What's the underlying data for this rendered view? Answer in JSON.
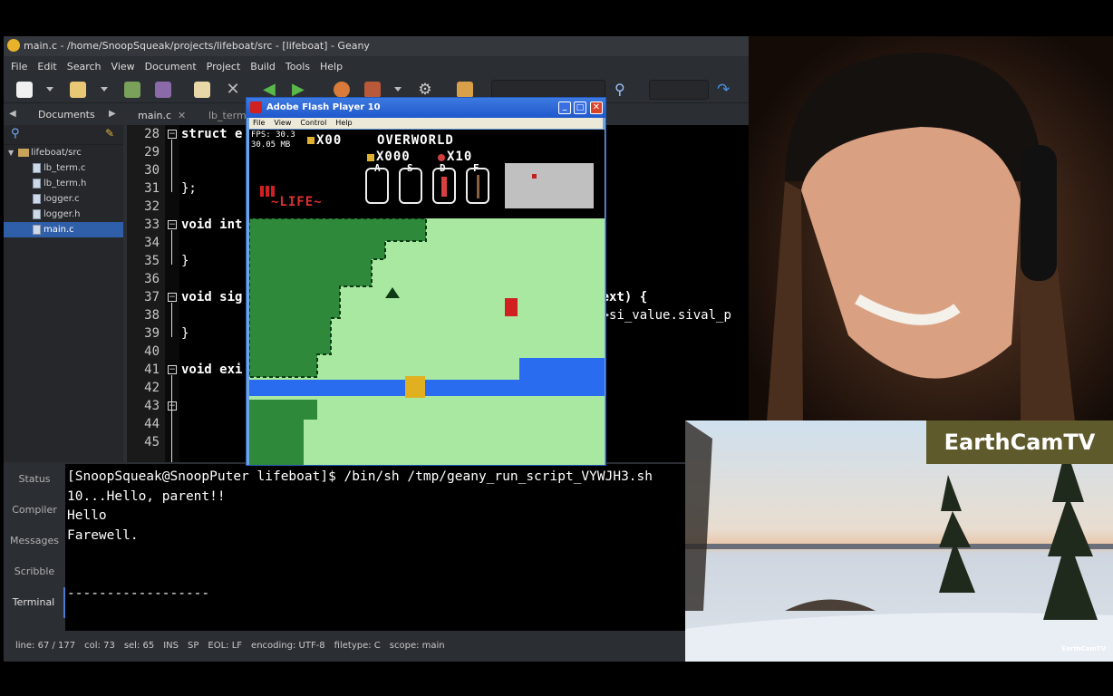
{
  "geany": {
    "title": "main.c - /home/SnoopSqueak/projects/lifeboat/src - [lifeboat] - Geany",
    "menu": [
      "File",
      "Edit",
      "Search",
      "View",
      "Document",
      "Project",
      "Build",
      "Tools",
      "Help"
    ],
    "sidebar_tab": "Documents",
    "tree": {
      "folder": "lifeboat/src",
      "files": [
        "lb_term.c",
        "lb_term.h",
        "logger.c",
        "logger.h",
        "main.c"
      ],
      "selected": "main.c"
    },
    "editor_tabs": [
      "main.c",
      "lb_term"
    ],
    "line_numbers": [
      "28",
      "29",
      "30",
      "31",
      "32",
      "33",
      "34",
      "35",
      "36",
      "37",
      "38",
      "39",
      "40",
      "41",
      "42",
      "43",
      "44",
      "45"
    ],
    "code_lines": [
      "struct e",
      "",
      "",
      "};",
      "",
      "void int",
      "",
      "}",
      "",
      "void sig                                             ntext) {",
      "                                                     p->si_value.sival_p",
      "}",
      "",
      "void exi",
      "",
      "",
      "",
      ""
    ],
    "message_tabs": [
      "Status",
      "Compiler",
      "Messages",
      "Scribble",
      "Terminal"
    ],
    "active_message_tab": "Terminal",
    "terminal_lines": [
      "[SnoopSqueak@SnoopPuter lifeboat]$ /bin/sh /tmp/geany_run_script_VYWJH3.sh",
      "10...Hello, parent!!",
      "Hello",
      "Farewell.",
      "",
      "",
      "------------------"
    ],
    "status": {
      "line": "line: 67 / 177",
      "col": "col: 73",
      "sel": "sel: 65",
      "mode": "INS",
      "sp": "SP",
      "eol": "EOL: LF",
      "encoding": "encoding: UTF-8",
      "filetype": "filetype: C",
      "scope": "scope: main"
    }
  },
  "flash": {
    "title": "Adobe Flash Player 10",
    "menu": [
      "File",
      "View",
      "Control",
      "Help"
    ],
    "fps": "FPS: 30.3",
    "mem": "30.05 MB",
    "keys": "X00",
    "area": "OVERWORLD",
    "rupees": "X000",
    "bombs": "X10",
    "slots": [
      "A",
      "S",
      "D",
      "F"
    ],
    "life": "~LIFE~"
  },
  "earthcam": {
    "brand": "EarthCamTV",
    "watermark": "EarthCamTV"
  },
  "colors": {
    "grass": "#a8e8a0",
    "tree": "#2e8a3a",
    "water": "#2a6cf0",
    "bridge": "#e0b020"
  }
}
